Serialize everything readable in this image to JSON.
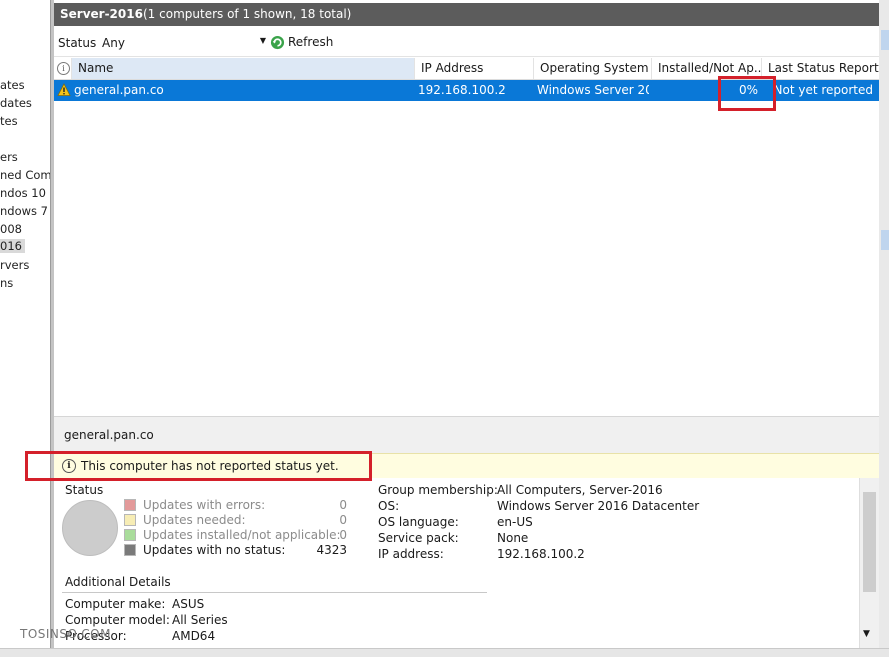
{
  "tree": {
    "items": [
      "ates",
      "dates",
      "tes",
      "ers",
      "ned Comp",
      "ndos 10",
      "ndows 7",
      "008",
      "016",
      "rvers",
      "ns"
    ]
  },
  "header": {
    "title": "Server-2016",
    "count": "(1 computers of 1 shown, 18 total)"
  },
  "toolbar": {
    "status_label": "Status:",
    "status_value": "Any",
    "refresh_label": "Refresh"
  },
  "grid": {
    "columns": [
      "Name",
      "IP Address",
      "Operating System",
      "Installed/Not Ap...",
      "Last Status Report"
    ],
    "rows": [
      {
        "name": "general.pan.co",
        "ip": "192.168.100.2",
        "os": "Windows Server 20...",
        "installed": "0%",
        "last_report": "Not yet reported"
      }
    ]
  },
  "details": {
    "computer_name": "general.pan.co",
    "notice": "This computer has not reported status yet.",
    "status_title": "Status",
    "legend": [
      {
        "label": "Updates with errors:",
        "value": "0",
        "color": "#e39a9a"
      },
      {
        "label": "Updates needed:",
        "value": "0",
        "color": "#f7edb5"
      },
      {
        "label": "Updates installed/not applicable:",
        "value": "0",
        "color": "#a9dc9b"
      },
      {
        "label": "Updates with no status:",
        "value": "4323",
        "color": "#7a7a7a"
      }
    ],
    "properties": [
      {
        "key": "Group membership:",
        "value": "All Computers, Server-2016"
      },
      {
        "key": "OS:",
        "value": "Windows Server 2016 Datacenter"
      },
      {
        "key": "OS language:",
        "value": "en-US"
      },
      {
        "key": "Service pack:",
        "value": "None"
      },
      {
        "key": "IP address:",
        "value": "192.168.100.2"
      }
    ],
    "additional_title": "Additional Details",
    "additional": [
      {
        "key": "Computer make:",
        "value": "ASUS"
      },
      {
        "key": "Computer model:",
        "value": "All Series"
      },
      {
        "key": "Processor:",
        "value": "AMD64"
      }
    ]
  },
  "watermark": "TOSINSO.COM",
  "colors": {
    "selection": "#0a78d7",
    "titlebar": "#5c5c5c",
    "highlight": "#d4202a",
    "notice_bg": "#fffde0"
  }
}
